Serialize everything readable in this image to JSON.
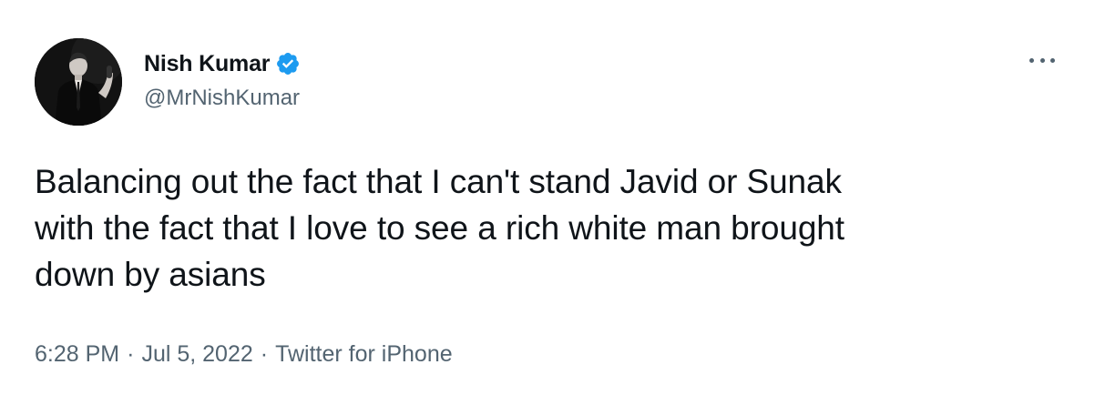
{
  "author": {
    "display_name": "Nish Kumar",
    "handle": "@MrNishKumar",
    "verified": true,
    "avatar_icon": "profile-photo"
  },
  "tweet": {
    "text": "Balancing out the fact that I can't stand Javid or Sunak\nwith the fact that I love to see a rich white man brought\ndown by asians",
    "time": "6:28 PM",
    "date": "Jul 5, 2022",
    "source": "Twitter for iPhone",
    "separator": "·"
  },
  "icons": {
    "verified": "verified-badge-icon",
    "more": "more-options-icon"
  },
  "colors": {
    "text": "#0f1419",
    "secondary": "#536471",
    "verified_blue": "#1d9bf0",
    "background": "#ffffff"
  }
}
